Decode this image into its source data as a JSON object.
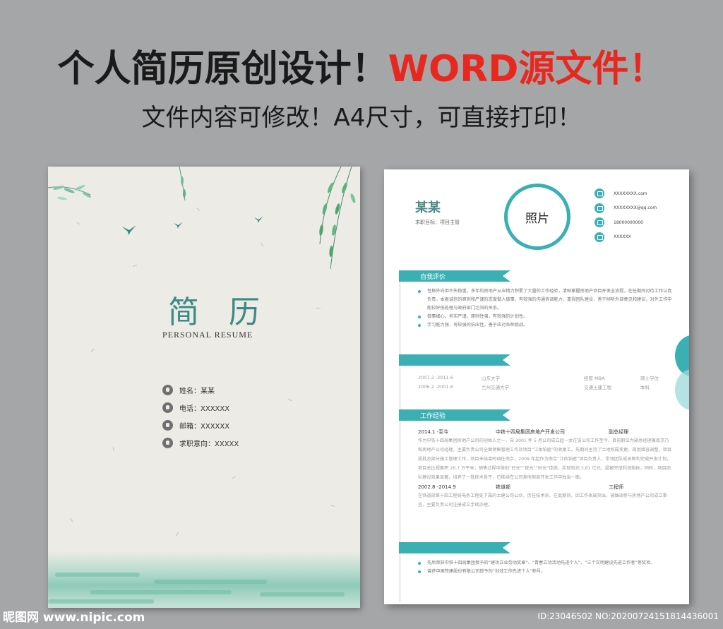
{
  "headline": {
    "main": "个人简历原创设计！",
    "highlight": "WORD源文件",
    "end": "！"
  },
  "subline": "文件内容可修改！A4尺寸，可直接打印！",
  "cover": {
    "title": "简 历",
    "subtitle": "PERSONAL RESUME",
    "info": [
      {
        "icon": "person-icon",
        "text": "姓名：某某"
      },
      {
        "icon": "phone-icon",
        "text": "电话：XXXXXX"
      },
      {
        "icon": "mail-icon",
        "text": "邮箱：XXXXXX"
      },
      {
        "icon": "search-icon",
        "text": "求职意向：XXXXX"
      }
    ]
  },
  "resume": {
    "name": "某某",
    "target": "求职目标：项目主管",
    "photo": "照片",
    "contacts": [
      {
        "icon": "screen-icon",
        "text": "XXXXXXXX.com"
      },
      {
        "icon": "mail-icon",
        "text": "XXXXXXXX@qq.com"
      },
      {
        "icon": "phone-icon",
        "text": "18000000000"
      },
      {
        "icon": "location-icon",
        "text": "XXXXXX"
      }
    ],
    "sections": {
      "self_eval": "自我评价",
      "education": "",
      "work": "工作经验",
      "awards": ""
    },
    "self_eval_items": [
      "性格外向但不失稳重，多年的房地产从业精力积累了大量的工作经验，清晰掌握房地产项目开发全流程，在任期间对待工作认真负责，本着诚信的原则和严谨的态度做人做事，有较强的沟通协调能力，重视团队建设，善于倾听外部意见和建议，对外工作中能较好低处理与政府部门之间的关系。",
      "做事细心、务实严谨，原则性强，有较强的计划性。",
      "学习能力强，有较强的抗压性，善于应对各种挑战。"
    ],
    "education": [
      {
        "period": "2007.2 -2011.6",
        "school": "山东大学",
        "major": "经管 MBA",
        "degree": "硕士学位"
      },
      {
        "period": "2006.2 -2001.6",
        "school": "兰州交通大学",
        "major": "交通土建工程",
        "degree": "本科"
      }
    ],
    "work": [
      {
        "period": "2014.1 -至今",
        "company": "中铁十四局集团房地产开发公司",
        "role": "副总经理",
        "desc": "作为中铁十四局集团房地产公司的创始人之一，自 2001 年 5 月公司成立起一女在该公司工作至今，目前职位为副总经理兼南京乃和房地产公司经理，主要负责公司全面销售管理工作及项目“江佑铂庭”的收尾工。先期间主持了土地权属变更，规划增容调整，项目投批及部分施工管理工作，项目未结束时调往南京。2009 年起作为南京“江佑铂庭”项目负责人，带领团队成员顺利完成开发计划，项目总比规面积 26.7 万平米，销售过程中陵创“日光”“夜光”“时光”佳绩，实现利润 3.61 亿元，超额完成利润指标，同时，项目团队建设效果显著，培养了一批技术骨干，已陆续在公司其他项目开发工作中独当一面。"
      },
      {
        "period": "2002.8 -2014.9",
        "company": "铁道部",
        "role": "工程师",
        "desc": "在铁道部第十四工程局电务工程处下属的土建公司公众，历任技术员、在此期间，因工作表现突出，被抽调参与房地产公司成立事宜，主要负责公司注册成立手续办理。"
      }
    ],
    "awards": [
      "先后荣获中铁十四局集团授予的“建功立业劳动奖章”、“青春立功活动先进个人”、“三个文明建设先进工作者”等奖项。",
      "曾获中国铁建股份有限公司授予的“创效工作先进个人”称号。"
    ]
  },
  "watermark": {
    "left": "昵图网 www.nipic.com",
    "right": "ID:23046502 NO:20200724151814436001"
  },
  "colors": {
    "accent": "#3ab0b4",
    "title_red": "#e8281f",
    "cover_bg": "#ecebe5",
    "background": "#a5a6a8"
  }
}
